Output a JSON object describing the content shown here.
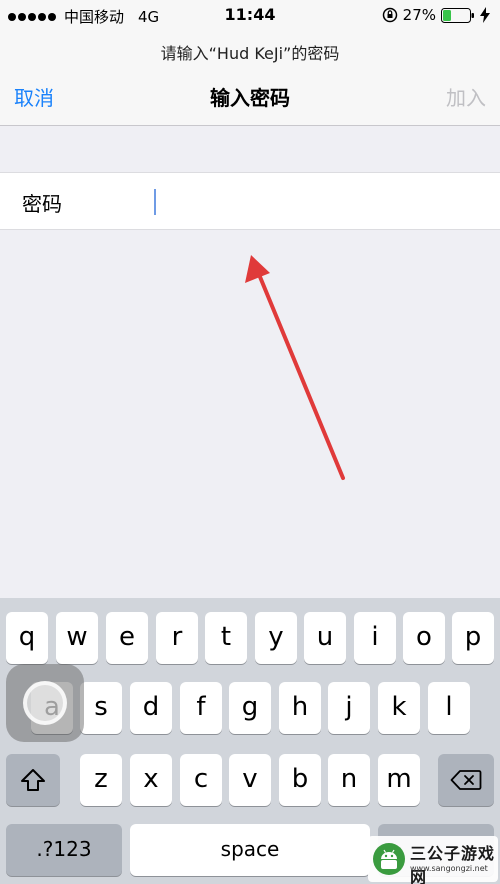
{
  "status_bar": {
    "carrier": "中国移动",
    "network": "4G",
    "time": "11:44",
    "battery_percent": "27%"
  },
  "header": {
    "prompt": "请输入“Hud    KeJi”的密码",
    "cancel_label": "取消",
    "title": "输入密码",
    "join_label": "加入"
  },
  "form": {
    "password_label": "密码",
    "password_value": ""
  },
  "keyboard": {
    "row1": [
      "q",
      "w",
      "e",
      "r",
      "t",
      "y",
      "u",
      "i",
      "o",
      "p"
    ],
    "row2": [
      "a",
      "s",
      "d",
      "f",
      "g",
      "h",
      "j",
      "k",
      "l"
    ],
    "row3": [
      "z",
      "x",
      "c",
      "v",
      "b",
      "n",
      "m"
    ],
    "numbers_label": ".?123",
    "space_label": "space"
  },
  "watermark": {
    "title": "三公子游戏网",
    "url": "www.sangongzi.net"
  },
  "colors": {
    "accent": "#1a82fb",
    "disabled": "#c0c0c4",
    "arrow": "#e03a3a",
    "keyboard_bg": "#d1d5db"
  }
}
